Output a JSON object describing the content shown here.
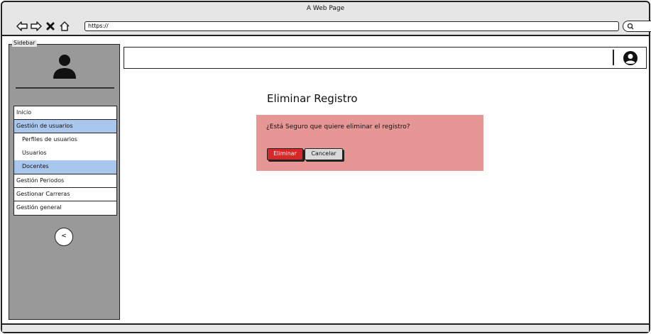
{
  "window": {
    "title": "A Web Page",
    "url": "https://"
  },
  "sidebar": {
    "legend": "Sidebar",
    "menu": [
      {
        "label": "Inicio"
      },
      {
        "label": "Gestión de usuarios",
        "selected": true
      },
      {
        "label": "Gestión Periodos"
      },
      {
        "label": "Gestionar Carreras"
      },
      {
        "label": "Gestión general"
      }
    ],
    "submenu": [
      {
        "label": "Perfiles de usuarios"
      },
      {
        "label": "Usuarios"
      },
      {
        "label": "Docentes",
        "selected": true
      }
    ],
    "collapse_label": "<"
  },
  "main": {
    "title": "Eliminar Registro",
    "alert": {
      "message": "¿Está Seguro que quiere eliminar el registro?",
      "delete_label": "Eliminar",
      "cancel_label": "Cancelar"
    }
  },
  "colors": {
    "selected": "#a9c6ec",
    "alert_bg": "#e79696",
    "danger": "#d62828",
    "sidebar_bg": "#999999"
  },
  "icons": [
    "back-arrow-icon",
    "forward-arrow-icon",
    "close-icon",
    "home-icon",
    "search-icon",
    "user-avatar-icon",
    "user-circle-icon"
  ]
}
